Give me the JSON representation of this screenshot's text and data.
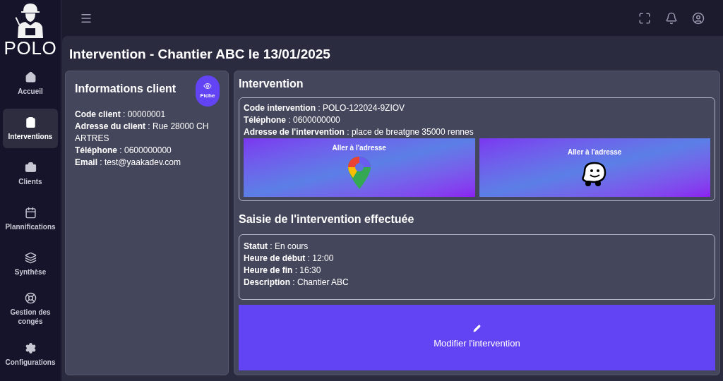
{
  "logo": {
    "text": "POLO"
  },
  "sidebar": {
    "items": [
      {
        "label": "Accueil",
        "selected": false
      },
      {
        "label": "Interventions",
        "selected": true
      },
      {
        "label": "Clients",
        "selected": false
      },
      {
        "label": "Plannifications",
        "selected": false
      },
      {
        "label": "Synthèse",
        "selected": false
      },
      {
        "label": "Gestion des congés",
        "selected": false
      },
      {
        "label": "Configurations",
        "selected": false
      }
    ]
  },
  "page_title": "Intervention - Chantier ABC le 13/01/2025",
  "client_card": {
    "title": "Informations client",
    "button": "Fiche",
    "lines": [
      "**Code client** : 00000001",
      "**Adresse du client** : Rue 28000 CHARTRES",
      "**Téléphone** : 0600000000",
      "**Email** : test@yaakadev.com"
    ]
  },
  "intervention": {
    "title": "Intervention",
    "lines": [
      "**Code intervention** : POLO-122024-9ZIOV",
      "**Téléphone** : 0600000000",
      "**Adresse de l'intervention** : place de breatgne 35000 rennes"
    ],
    "nav_buttons": [
      {
        "label": "Aller à l'adresse",
        "kind": "maps"
      },
      {
        "label": "Aller à l'adresse",
        "kind": "waze"
      }
    ]
  },
  "saisie": {
    "title": "Saisie de l'intervention effectuée",
    "lines": [
      "**Statut** : En cours",
      "**Heure de début** : 12:00",
      "**Heure de fin** : 16:30",
      "**Description** : Chantier ABC"
    ],
    "button": "Modifier l'intervention"
  }
}
